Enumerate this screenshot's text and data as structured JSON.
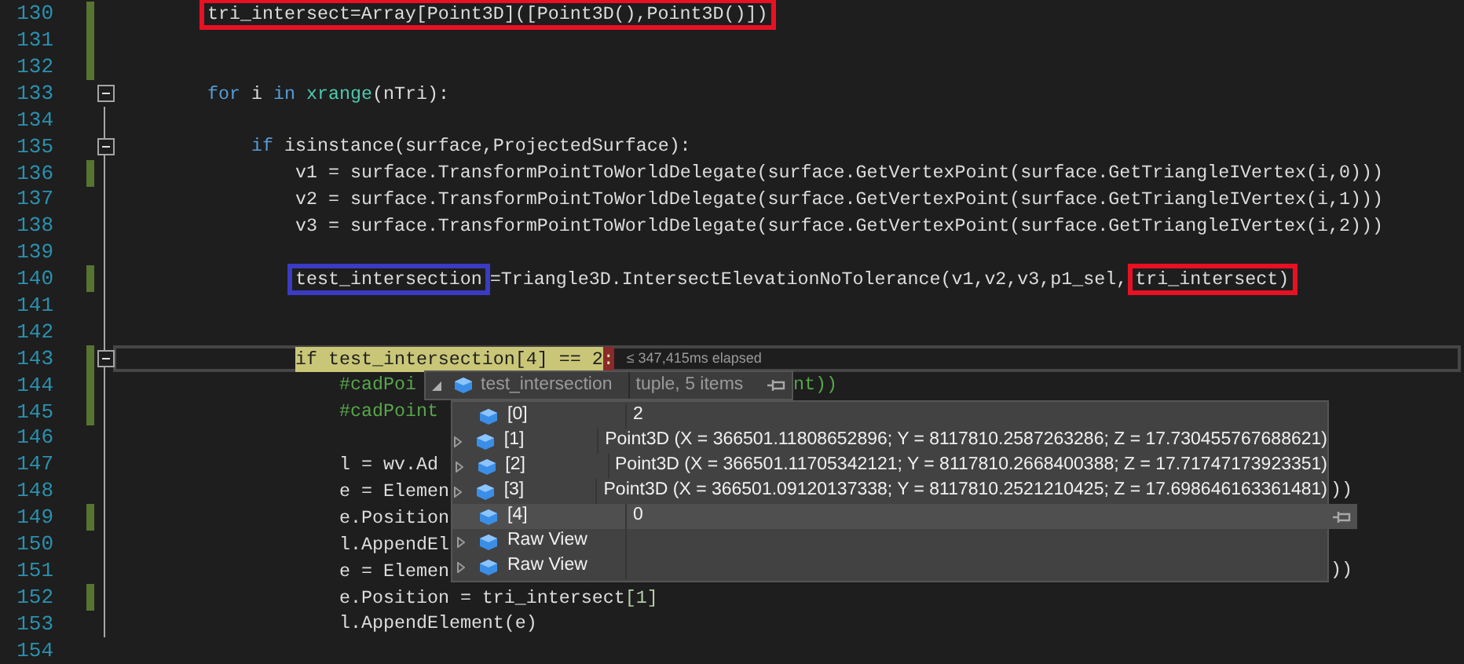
{
  "editor": {
    "lines": [
      {
        "number": "130",
        "changed": true,
        "fold": false,
        "tokens": [
          {
            "text": "tri_intersect=Array[Point3D]([Point3D(),Point3D()])",
            "kind": "plain",
            "frame": {
              "color": "#e81123"
            }
          }
        ]
      },
      {
        "number": "131",
        "changed": true,
        "fold": false
      },
      {
        "number": "132",
        "changed": true,
        "fold": false
      },
      {
        "number": "133",
        "changed": false,
        "fold": true,
        "tokens": [
          {
            "text": "for",
            "kind": "keyword"
          },
          {
            "text": " i ",
            "kind": "plain"
          },
          {
            "text": "in",
            "kind": "keyword"
          },
          {
            "text": " xrange",
            "kind": "builtin"
          },
          {
            "text": "(nTri):",
            "kind": "plain"
          }
        ],
        "children": [
          {
            "number": "134",
            "changed": false,
            "fold": false
          },
          {
            "number": "135",
            "changed": false,
            "fold": true,
            "tokens": [
              {
                "text": "if",
                "kind": "keyword"
              },
              {
                "text": " isinstance(surface,ProjectedSurface):",
                "kind": "plain"
              }
            ],
            "children": [
              {
                "number": "136",
                "changed": true,
                "fold": false,
                "tokens": [
                  {
                    "text": "v1 = surface.TransformPointToWorldDelegate(surface.GetVertexPoint(surface.GetTriangleIVertex(i,0)))",
                    "kind": "plain"
                  }
                ]
              },
              {
                "number": "137",
                "changed": false,
                "fold": false,
                "tokens": [
                  {
                    "text": "v2 = surface.TransformPointToWorldDelegate(surface.GetVertexPoint(surface.GetTriangleIVertex(i,1)))",
                    "kind": "plain"
                  }
                ]
              },
              {
                "number": "138",
                "changed": false,
                "fold": false,
                "tokens": [
                  {
                    "text": "v3 = surface.TransformPointToWorldDelegate(surface.GetVertexPoint(surface.GetTriangleIVertex(i,2)))",
                    "kind": "plain"
                  }
                ]
              },
              {
                "number": "139",
                "changed": false,
                "fold": false
              },
              {
                "number": "140",
                "changed": true,
                "fold": false,
                "tokens": [
                  {
                    "text": "test_intersection",
                    "kind": "plain",
                    "frame": {
                      "color": "#3b3bc4"
                    }
                  },
                  {
                    "text": "=Triangle3D.IntersectElevationNoTolerance(v1,v2,v3,p1_sel,",
                    "kind": "plain"
                  },
                  {
                    "text": "tri_intersect)",
                    "kind": "plain",
                    "frame": {
                      "color": "#e81123"
                    }
                  }
                ]
              },
              {
                "number": "141",
                "changed": false,
                "fold": false
              },
              {
                "number": "142",
                "changed": false,
                "fold": false
              },
              {
                "number": "143",
                "changed": true,
                "fold": true,
                "current": true,
                "tokens": [
                  {
                    "text": "if test_intersection[4] == 2",
                    "kind": "statement"
                  },
                  {
                    "text": ":",
                    "kind": "stop"
                  }
                ],
                "note": "≤ 347,415ms elapsed",
                "children": [
                  {
                    "number": "144",
                    "changed": true,
                    "fold": false,
                    "tokens": [
                      {
                        "text": "#cadPoi",
                        "kind": "comment"
                      }
                    ],
                    "tail": {
                      "kind": "after-header",
                      "tokens": [
                        {
                          "text": "nt))",
                          "kind": "comment"
                        }
                      ]
                    }
                  },
                  {
                    "number": "145",
                    "changed": true,
                    "fold": false,
                    "tokens": [
                      {
                        "text": "#cadPoint",
                        "kind": "comment"
                      }
                    ]
                  },
                  {
                    "number": "146",
                    "changed": false,
                    "fold": false
                  },
                  {
                    "number": "147",
                    "changed": false,
                    "fold": false,
                    "tokens": [
                      {
                        "text": "l = wv.Ad",
                        "kind": "plain"
                      }
                    ]
                  },
                  {
                    "number": "148",
                    "changed": false,
                    "fold": false,
                    "tokens": [
                      {
                        "text": "e = Elemen",
                        "kind": "plain"
                      }
                    ],
                    "tail": {
                      "kind": "after-body",
                      "tokens": [
                        {
                          "text": "))",
                          "kind": "plain"
                        }
                      ]
                    }
                  },
                  {
                    "number": "149",
                    "changed": true,
                    "fold": false,
                    "tokens": [
                      {
                        "text": "e.Position",
                        "kind": "plain"
                      }
                    ]
                  },
                  {
                    "number": "150",
                    "changed": false,
                    "fold": false,
                    "tokens": [
                      {
                        "text": "l.AppendEl",
                        "kind": "plain"
                      }
                    ]
                  },
                  {
                    "number": "151",
                    "changed": false,
                    "fold": false,
                    "tokens": [
                      {
                        "text": "e = Elemen",
                        "kind": "plain"
                      }
                    ],
                    "tail": {
                      "kind": "after-body",
                      "tokens": [
                        {
                          "text": "))",
                          "kind": "plain"
                        }
                      ]
                    }
                  },
                  {
                    "number": "152",
                    "changed": true,
                    "fold": false,
                    "tokens": [
                      {
                        "text": "e.Position = tri_intersect",
                        "kind": "plain"
                      },
                      {
                        "text": "[1]",
                        "kind": "number"
                      }
                    ]
                  },
                  {
                    "number": "153",
                    "changed": false,
                    "fold": false,
                    "tokens": [
                      {
                        "text": "l.AppendElement(e)",
                        "kind": "plain"
                      }
                    ]
                  }
                ]
              }
            ]
          }
        ]
      },
      {
        "number": "154",
        "changed": false,
        "fold": false
      }
    ]
  },
  "datatip": {
    "expression": "test_intersection",
    "type": "tuple, 5 items",
    "rows": [
      {
        "name": "[0]",
        "value": "2",
        "expandable": false,
        "selected": false
      },
      {
        "name": "[1]",
        "value": "Point3D (X = 366501.11808652896; Y = 8117810.2587263286; Z = 17.730455767688621)",
        "expandable": true,
        "selected": false
      },
      {
        "name": "[2]",
        "value": "Point3D (X = 366501.11705342121; Y = 8117810.2668400388; Z = 17.71747173923351)",
        "expandable": true,
        "selected": false
      },
      {
        "name": "[3]",
        "value": "Point3D (X = 366501.09120137338; Y = 8117810.2521210425; Z = 17.698646163361481)",
        "expandable": true,
        "selected": false
      },
      {
        "name": "[4]",
        "value": "0",
        "expandable": false,
        "selected": true
      },
      {
        "name": "Raw View",
        "expandable": true,
        "selected": false
      },
      {
        "name": "Raw View",
        "expandable": true,
        "selected": false
      }
    ]
  }
}
